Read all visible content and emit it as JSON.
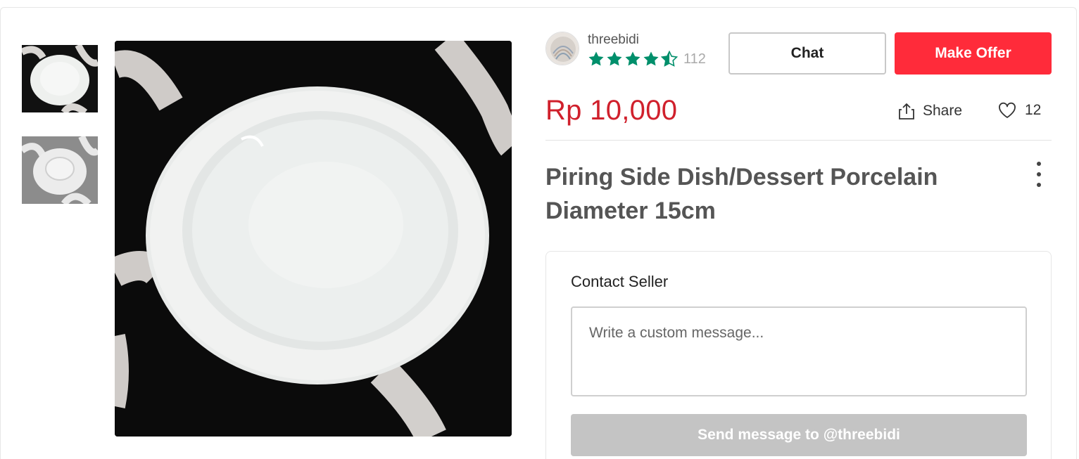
{
  "gallery": {
    "thumbnails": [
      {
        "name": "thumbnail-plate-top"
      },
      {
        "name": "thumbnail-plate-bottom"
      }
    ]
  },
  "seller": {
    "username": "threebidi",
    "rating": 4.5,
    "review_count": "112"
  },
  "actions": {
    "chat_label": "Chat",
    "offer_label": "Make Offer"
  },
  "listing": {
    "price": "Rp 10,000",
    "share_label": "Share",
    "like_count": "12",
    "title": "Piring Side Dish/Dessert Porcelain Diameter 15cm"
  },
  "contact": {
    "heading": "Contact Seller",
    "placeholder": "Write a custom message...",
    "send_label": "Send message to @threebidi"
  },
  "colors": {
    "brand_red": "#ff2b3a",
    "price_red": "#d0202c",
    "star_green": "#008f6b",
    "disabled_gray": "#c4c4c4"
  }
}
